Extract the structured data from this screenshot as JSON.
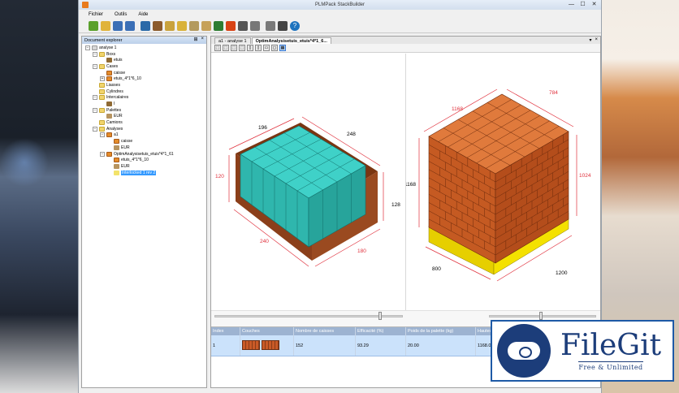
{
  "window": {
    "title": "PLMPack StackBuilder",
    "controls": [
      "—",
      "☐",
      "✕"
    ]
  },
  "menu": {
    "items": [
      "Fichier",
      "Outils",
      "Aide"
    ]
  },
  "toolbar": {
    "buttons": [
      {
        "icon": "new-document-icon",
        "color": "#5aa02c"
      },
      {
        "icon": "open-folder-icon",
        "color": "#e0b33a"
      },
      {
        "icon": "save-icon",
        "color": "#3b6fb6"
      },
      {
        "icon": "save-all-icon",
        "color": "#3b6fb6"
      },
      {
        "icon": "new-box-icon",
        "color": "#2b6aa8"
      },
      {
        "icon": "new-case-icon",
        "color": "#8b5a2b"
      },
      {
        "icon": "new-bundle-icon",
        "color": "#c9a23c"
      },
      {
        "icon": "new-cylinder-icon",
        "color": "#d9b23a"
      },
      {
        "icon": "new-interlayer-icon",
        "color": "#b39a5e"
      },
      {
        "icon": "new-pallet-icon",
        "color": "#c6a15a"
      },
      {
        "icon": "new-truck-icon",
        "color": "#2e7d32"
      },
      {
        "icon": "new-analysis-icon",
        "color": "#d84315"
      },
      {
        "icon": "new-case-analysis-icon",
        "color": "#555555"
      },
      {
        "icon": "new-truck-analysis-icon",
        "color": "#777777"
      },
      {
        "icon": "optimise-icon",
        "color": "#7a7a7a"
      },
      {
        "icon": "ect-analysis-icon",
        "color": "#444444"
      },
      {
        "icon": "help-icon",
        "color": "#1e73be"
      }
    ]
  },
  "explorer": {
    "title": "Document explorer",
    "tree": [
      {
        "level": 0,
        "expander": "−",
        "icon": "doc",
        "label": "analyse 1"
      },
      {
        "level": 1,
        "expander": "−",
        "icon": "folder",
        "label": "Boxs"
      },
      {
        "level": 2,
        "expander": "",
        "icon": "case",
        "label": "etuis"
      },
      {
        "level": 1,
        "expander": "−",
        "icon": "folder",
        "label": "Cases"
      },
      {
        "level": 2,
        "expander": "",
        "icon": "box",
        "label": "caisse"
      },
      {
        "level": 2,
        "expander": "+",
        "icon": "box",
        "label": "etuis_4*1*6_10"
      },
      {
        "level": 1,
        "expander": "",
        "icon": "folder",
        "label": "Liasses"
      },
      {
        "level": 1,
        "expander": "",
        "icon": "folder",
        "label": "Cylindres"
      },
      {
        "level": 1,
        "expander": "−",
        "icon": "folder",
        "label": "Intercalaires"
      },
      {
        "level": 2,
        "expander": "",
        "icon": "case",
        "label": "I"
      },
      {
        "level": 1,
        "expander": "−",
        "icon": "folder",
        "label": "Palettes"
      },
      {
        "level": 2,
        "expander": "",
        "icon": "pallet",
        "label": "EUR"
      },
      {
        "level": 1,
        "expander": "",
        "icon": "folder",
        "label": "Camions"
      },
      {
        "level": 1,
        "expander": "−",
        "icon": "folder",
        "label": "Analyses"
      },
      {
        "level": 2,
        "expander": "−",
        "icon": "box",
        "label": "a1"
      },
      {
        "level": 3,
        "expander": "",
        "icon": "box",
        "label": "caisse"
      },
      {
        "level": 3,
        "expander": "",
        "icon": "pallet",
        "label": "EUR"
      },
      {
        "level": 2,
        "expander": "−",
        "icon": "box",
        "label": "OptimAnalysisetuis_etuis*4*1_61"
      },
      {
        "level": 3,
        "expander": "",
        "icon": "box",
        "label": "etuis_4*1*6_10"
      },
      {
        "level": 3,
        "expander": "",
        "icon": "pallet",
        "label": "EUR"
      },
      {
        "level": 3,
        "expander": "",
        "icon": "bulb",
        "label": "Interlocked 1 rev 2",
        "selected": true
      }
    ]
  },
  "tabs": [
    {
      "label": "a1 - analyse 1",
      "active": false
    },
    {
      "label": "OptimAnalysisetuis_etuis*4*1_6...",
      "active": true
    }
  ],
  "viewbar": {
    "buttons": [
      "⬚",
      "⬚",
      "⬚",
      "⬚",
      "▯",
      "▯",
      "▭",
      "◻",
      "▦"
    ]
  },
  "case_view": {
    "dims": {
      "top_depth": "196",
      "top_width": "248",
      "left_height": "120",
      "right_height": "128",
      "bottom_width": "240",
      "bottom_depth": "180"
    },
    "colors": {
      "case": "#8b3f1a",
      "box_top": "#3fd1c8",
      "box_side": "#2fb6ad",
      "box_front": "#27a49b"
    }
  },
  "pallet_view": {
    "dims": {
      "top_depth": "1168",
      "top_width": "784",
      "left_height": "1168",
      "right_height": "1024",
      "bottom_width": "1200",
      "bottom_depth": "800"
    },
    "colors": {
      "brick_top": "#e07a3c",
      "brick_side": "#c55a22",
      "brick_front": "#b44d1b",
      "pallet": "#f4e100"
    }
  },
  "grid": {
    "headers": [
      "Index",
      "Couches",
      "Nombre de caisses",
      "Efficacité (%)",
      "Poids de la palette (kg)",
      "Hauteur"
    ],
    "row": {
      "index": "1",
      "cases": "152",
      "efficiency": "93.29",
      "weight": "20.00",
      "height": "1168.0..."
    }
  },
  "watermark": {
    "title": "FileGit",
    "subtitle": "Free & Unlimited"
  }
}
